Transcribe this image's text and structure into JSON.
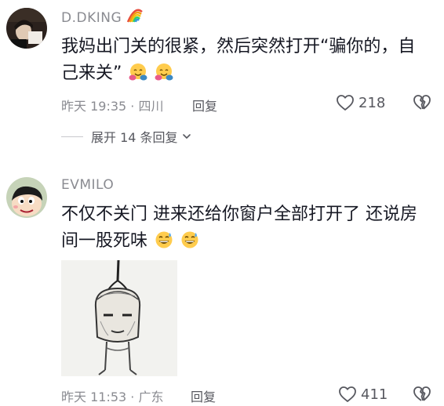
{
  "comments": [
    {
      "username": "D.DKING",
      "text": "我妈出门关的很紧，然后突然打开“骗你的，自己来关”",
      "emojis": [
        "hugging-face-icon",
        "hugging-face-icon"
      ],
      "time_location": "昨天 19:35 · 四川",
      "reply_label": "回复",
      "likes": "218",
      "expand_label": "展开 14 条回复"
    },
    {
      "username": "EVMILO",
      "text": "不仅不关门 进来还给你窗户全部打开了 还说房间一股死味",
      "emojis": [
        "grinning-sweat-face-icon",
        "grinning-sweat-face-icon"
      ],
      "time_location": "昨天 11:53 · 广东",
      "reply_label": "回复",
      "likes": "411"
    }
  ],
  "colors": {
    "text_primary": "#161823",
    "text_secondary": "#8a8b91",
    "icon": "#57585f"
  }
}
